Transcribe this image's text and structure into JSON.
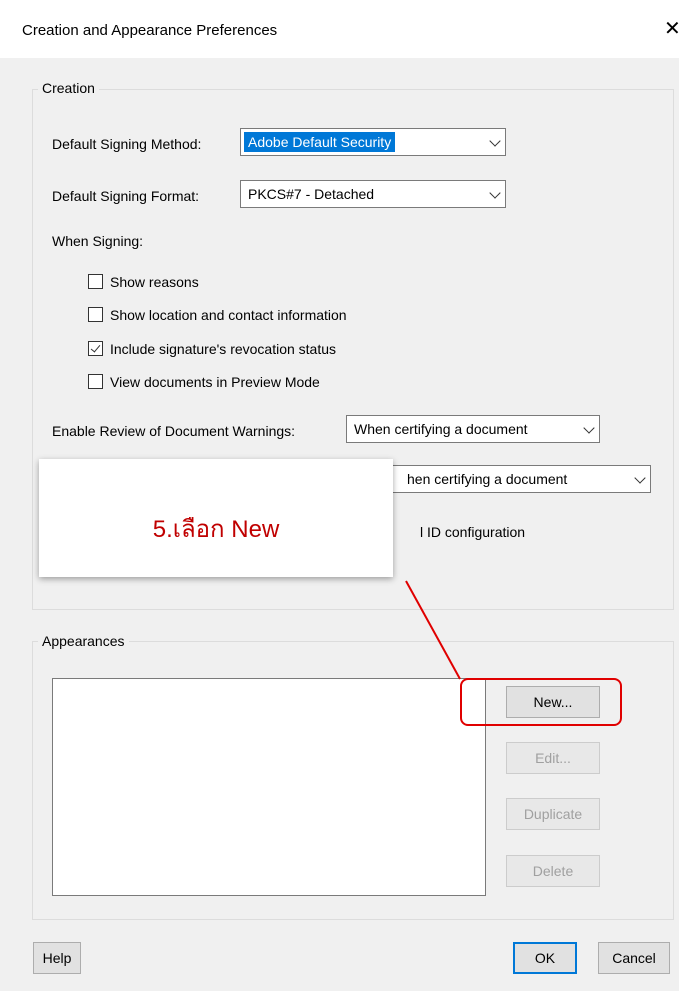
{
  "window": {
    "title": "Creation and Appearance Preferences",
    "close_glyph": "✕"
  },
  "creation": {
    "legend": "Creation",
    "signing_method_label": "Default Signing Method:",
    "signing_method_value": "Adobe Default Security",
    "signing_format_label": "Default Signing Format:",
    "signing_format_value": "PKCS#7 - Detached",
    "when_signing_label": "When Signing:",
    "checkboxes": [
      {
        "label": "Show reasons",
        "checked": false
      },
      {
        "label": "Show location and contact information",
        "checked": false
      },
      {
        "label": "Include signature's revocation status",
        "checked": true
      },
      {
        "label": "View documents in Preview Mode",
        "checked": false
      }
    ],
    "review_warnings_label": "Enable Review of Document Warnings:",
    "review_warnings_value": "When certifying a document",
    "prevent_signing_value_partial": "hen certifying a document",
    "digital_id_text_partial": "l ID configuration"
  },
  "appearances": {
    "legend": "Appearances",
    "buttons": {
      "new": "New...",
      "edit": "Edit...",
      "duplicate": "Duplicate",
      "delete": "Delete"
    }
  },
  "footer": {
    "help": "Help",
    "ok": "OK",
    "cancel": "Cancel"
  },
  "annotation": {
    "callout_text": "5.เลือก New",
    "accent_color": "#e00000"
  }
}
